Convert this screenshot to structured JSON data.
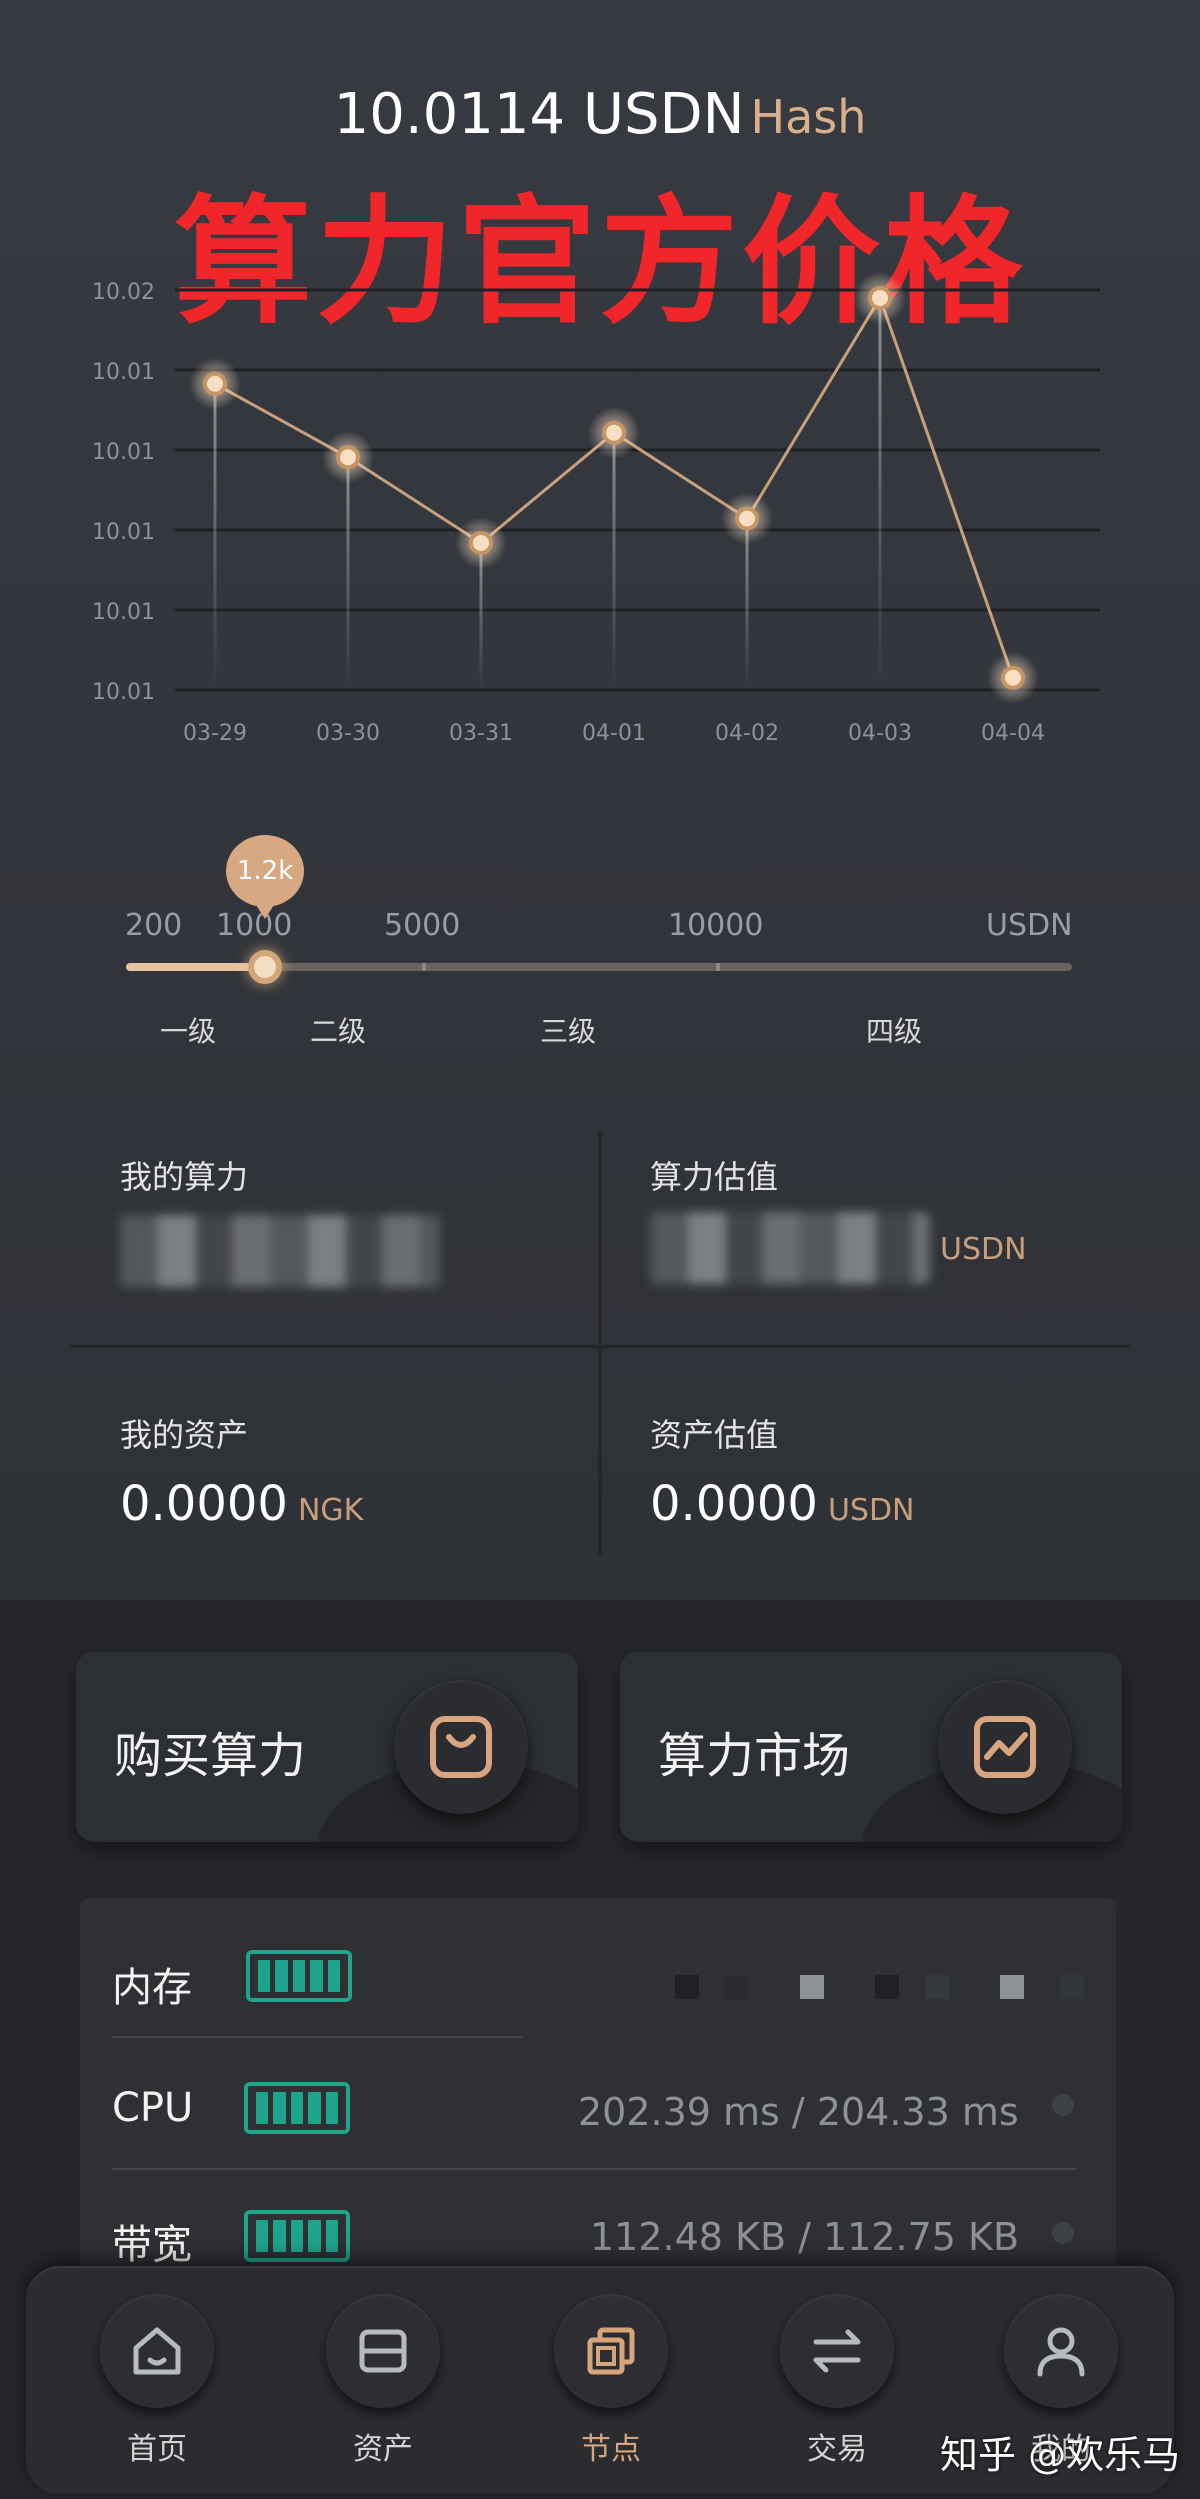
{
  "header": {
    "price_value": "10.0114 USDN",
    "price_unit": "Hash",
    "overlay_title": "算力官方价格"
  },
  "chart_data": {
    "type": "line",
    "categories": [
      "03-29",
      "03-30",
      "03-31",
      "04-01",
      "04-02",
      "04-03",
      "04-04"
    ],
    "values": [
      10.013,
      10.0124,
      10.0117,
      10.0126,
      10.0119,
      10.0137,
      10.0106
    ],
    "y_tick_labels": [
      "10.02",
      "10.01",
      "10.01",
      "10.01",
      "10.01",
      "10.01"
    ],
    "ylim": [
      10.0105,
      10.0137
    ],
    "grid": true,
    "colors": {
      "line": "#c9a07c",
      "point": "#f6dfc3",
      "grid": "#1e2024",
      "label": "#8e9197"
    }
  },
  "slider": {
    "bubble": "1.2k",
    "tick_labels": [
      "200",
      "1000",
      "5000",
      "10000",
      "USDN"
    ],
    "level_labels": [
      "一级",
      "二级",
      "三级",
      "四级"
    ],
    "current_fraction": 0.147
  },
  "stats": {
    "my_power_label": "我的算力",
    "power_value_label": "算力估值",
    "power_value_unit": "USDN",
    "my_assets_label": "我的资产",
    "my_assets_value": "0.0000",
    "my_assets_unit": "NGK",
    "assets_value_label": "资产估值",
    "assets_value_value": "0.0000",
    "assets_value_unit": "USDN"
  },
  "actions": {
    "buy_label": "购买算力",
    "market_label": "算力市场"
  },
  "resources": {
    "rows": [
      {
        "label": "内存",
        "value": ""
      },
      {
        "label": "CPU",
        "value": "202.39 ms / 204.33 ms"
      },
      {
        "label": "带宽",
        "value": "112.48 KB / 112.75 KB"
      }
    ],
    "battery_color": "#1ea48d"
  },
  "nav": {
    "items": [
      "首页",
      "资产",
      "节点",
      "交易",
      "我的"
    ],
    "active_index": 2,
    "active_color": "#d7a57c"
  },
  "watermark": "知乎 @欢乐马"
}
